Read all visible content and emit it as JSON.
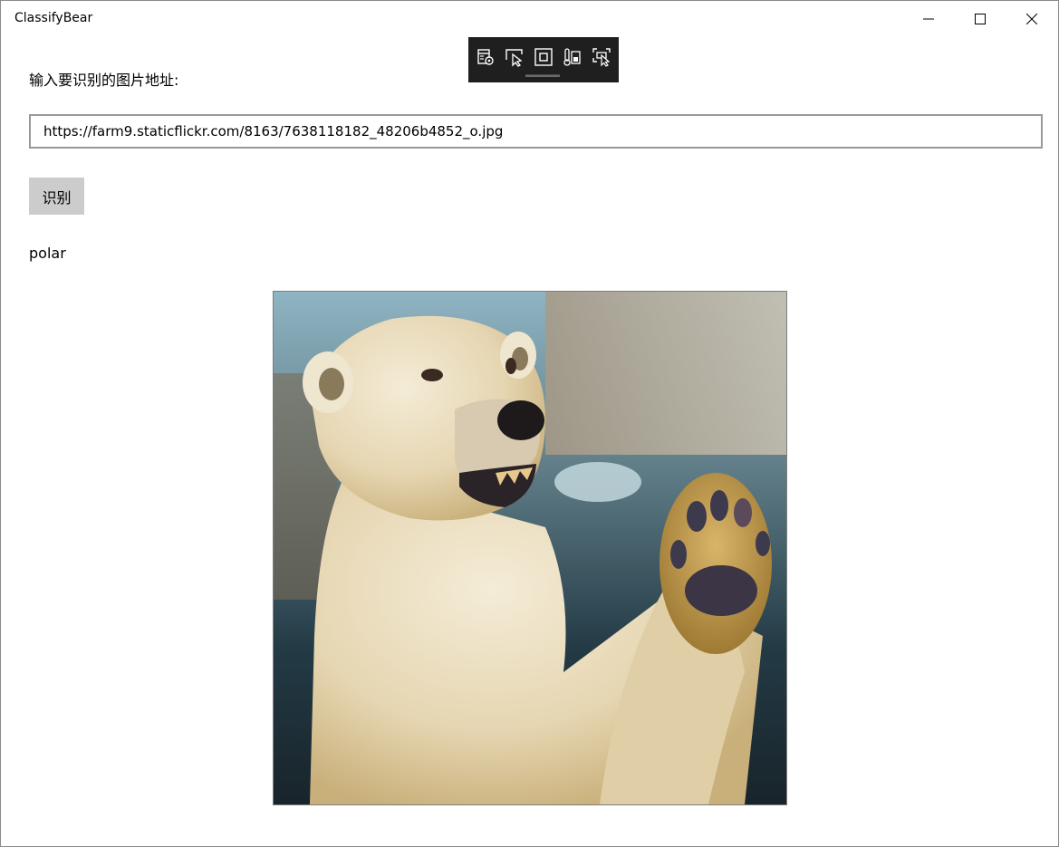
{
  "window": {
    "title": "ClassifyBear",
    "controls": {
      "minimize_icon": "minimize-icon",
      "maximize_icon": "maximize-icon",
      "close_icon": "close-icon"
    }
  },
  "devtools": {
    "icons": [
      "live-visual-tree-icon",
      "select-element-icon",
      "display-layout-adorners-icon",
      "track-focus-icon",
      "preview-selection-icon"
    ]
  },
  "form": {
    "prompt": "输入要识别的图片地址:",
    "url_value": "https://farm9.staticflickr.com/8163/7638118182_48206b4852_o.jpg",
    "button_label": "识别"
  },
  "result": {
    "label": "polar"
  },
  "colors": {
    "window_bg": "#ffffff",
    "button_bg": "#cccccc",
    "input_border": "#999999",
    "devbar_bg": "#1f1f1f"
  }
}
